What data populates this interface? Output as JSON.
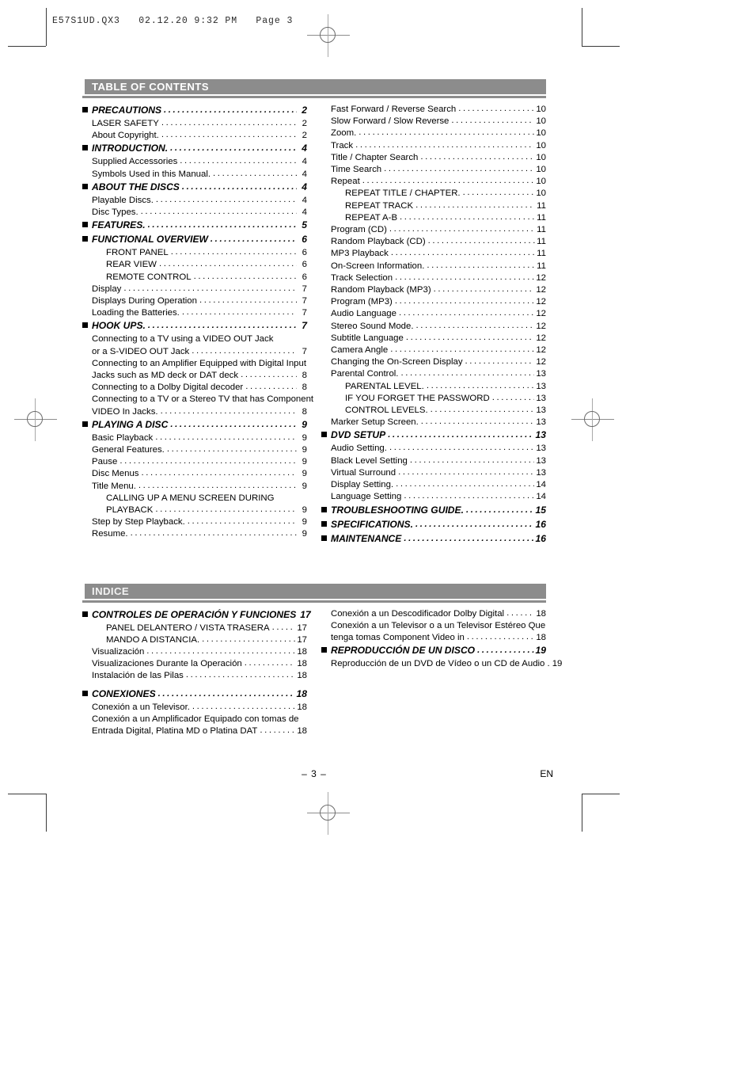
{
  "slug": "E57S1UD.QX3   02.12.20 9:32 PM   Page 3",
  "footer": {
    "page_number": "– 3 –",
    "language_code": "EN"
  },
  "colors": {
    "header_bar": "#8c8c8c",
    "header_text": "#ffffff",
    "body_text": "#000000"
  },
  "sections": [
    {
      "id": "table-of-contents",
      "title": "TABLE OF CONTENTS",
      "columns": [
        {
          "entries": [
            {
              "level": 0,
              "label": "PRECAUTIONS",
              "page": "2"
            },
            {
              "level": 1,
              "label": "LASER SAFETY",
              "page": "2"
            },
            {
              "level": 1,
              "label": "About Copyright.",
              "page": "2"
            },
            {
              "level": 0,
              "label": "INTRODUCTION.",
              "page": "4"
            },
            {
              "level": 1,
              "label": "Supplied Accessories",
              "page": "4"
            },
            {
              "level": 1,
              "label": "Symbols Used in this Manual.",
              "page": "4"
            },
            {
              "level": 0,
              "label": "ABOUT THE DISCS",
              "page": "4"
            },
            {
              "level": 1,
              "label": "Playable Discs.",
              "page": "4"
            },
            {
              "level": 1,
              "label": "Disc Types.",
              "page": "4"
            },
            {
              "level": 0,
              "label": "FEATURES.",
              "page": "5"
            },
            {
              "level": 0,
              "label": "FUNCTIONAL OVERVIEW",
              "page": "6"
            },
            {
              "level": 2,
              "label": "FRONT PANEL",
              "page": "6"
            },
            {
              "level": 2,
              "label": "REAR VIEW",
              "page": "6"
            },
            {
              "level": 2,
              "label": "REMOTE CONTROL",
              "page": "6"
            },
            {
              "level": 1,
              "label": "Display",
              "page": "7"
            },
            {
              "level": 1,
              "label": "Displays During Operation",
              "page": "7"
            },
            {
              "level": 1,
              "label": "Loading the Batteries.",
              "page": "7"
            },
            {
              "level": 0,
              "label": "HOOK UPS.",
              "page": "7"
            },
            {
              "level": 1,
              "label": "Connecting to a TV using a VIDEO OUT Jack",
              "page": "",
              "nodots": true
            },
            {
              "level": 1,
              "label": "or a S-VIDEO OUT Jack",
              "page": "7"
            },
            {
              "level": 1,
              "label": "Connecting to an Amplifier Equipped with Digital Input",
              "page": "",
              "nodots": true
            },
            {
              "level": 1,
              "label": "Jacks such as MD deck or DAT deck",
              "page": "8"
            },
            {
              "level": 1,
              "label": "Connecting to a Dolby Digital decoder",
              "page": "8"
            },
            {
              "level": 1,
              "label": "Connecting to a TV or a Stereo TV that has Component",
              "page": "",
              "nodots": true
            },
            {
              "level": 1,
              "label": "VIDEO In Jacks.",
              "page": "8"
            },
            {
              "level": 0,
              "label": "PLAYING A DISC",
              "page": "9"
            },
            {
              "level": 1,
              "label": "Basic Playback",
              "page": "9"
            },
            {
              "level": 1,
              "label": "General Features.",
              "page": "9"
            },
            {
              "level": 1,
              "label": "Pause",
              "page": "9"
            },
            {
              "level": 1,
              "label": "Disc Menus",
              "page": "9"
            },
            {
              "level": 1,
              "label": "Title Menu.",
              "page": "9"
            },
            {
              "level": 2,
              "label": "CALLING UP A MENU SCREEN DURING",
              "page": "",
              "nodots": true
            },
            {
              "level": 2,
              "label": "PLAYBACK",
              "page": "9"
            },
            {
              "level": 1,
              "label": "Step by Step Playback.",
              "page": "9"
            },
            {
              "level": 1,
              "label": "Resume.",
              "page": "9"
            }
          ]
        },
        {
          "entries": [
            {
              "level": 1,
              "label": "Fast Forward / Reverse Search",
              "page": "10"
            },
            {
              "level": 1,
              "label": "Slow Forward / Slow Reverse",
              "page": "10"
            },
            {
              "level": 1,
              "label": "Zoom.",
              "page": "10"
            },
            {
              "level": 1,
              "label": "Track",
              "page": "10"
            },
            {
              "level": 1,
              "label": "Title / Chapter Search",
              "page": "10"
            },
            {
              "level": 1,
              "label": "Time Search",
              "page": "10"
            },
            {
              "level": 1,
              "label": "Repeat",
              "page": "10"
            },
            {
              "level": 2,
              "label": "REPEAT TITLE / CHAPTER.",
              "page": "10"
            },
            {
              "level": 2,
              "label": "REPEAT TRACK",
              "page": "11"
            },
            {
              "level": 2,
              "label": "REPEAT A-B",
              "page": "11"
            },
            {
              "level": 1,
              "label": "Program (CD)",
              "page": "11"
            },
            {
              "level": 1,
              "label": "Random Playback (CD)",
              "page": "11"
            },
            {
              "level": 1,
              "label": "MP3 Playback",
              "page": "11"
            },
            {
              "level": 1,
              "label": "On-Screen Information.",
              "page": "11"
            },
            {
              "level": 1,
              "label": "Track Selection",
              "page": "12"
            },
            {
              "level": 1,
              "label": "Random Playback (MP3)",
              "page": "12"
            },
            {
              "level": 1,
              "label": "Program (MP3)",
              "page": "12"
            },
            {
              "level": 1,
              "label": "Audio Language",
              "page": "12"
            },
            {
              "level": 1,
              "label": "Stereo Sound Mode.",
              "page": "12"
            },
            {
              "level": 1,
              "label": "Subtitle Language",
              "page": "12"
            },
            {
              "level": 1,
              "label": "Camera Angle",
              "page": "12"
            },
            {
              "level": 1,
              "label": "Changing the On-Screen Display",
              "page": "12"
            },
            {
              "level": 1,
              "label": "Parental Control.",
              "page": "13"
            },
            {
              "level": 2,
              "label": "PARENTAL LEVEL.",
              "page": "13"
            },
            {
              "level": 2,
              "label": "IF YOU FORGET THE PASSWORD",
              "page": "13"
            },
            {
              "level": 2,
              "label": "CONTROL LEVELS.",
              "page": "13"
            },
            {
              "level": 1,
              "label": "Marker Setup Screen.",
              "page": "13"
            },
            {
              "level": 0,
              "label": "DVD SETUP",
              "page": "13"
            },
            {
              "level": 1,
              "label": "Audio Setting.",
              "page": "13"
            },
            {
              "level": 1,
              "label": "Black Level Setting",
              "page": "13"
            },
            {
              "level": 1,
              "label": "Virtual Surround",
              "page": "13"
            },
            {
              "level": 1,
              "label": "Display Setting.",
              "page": "14"
            },
            {
              "level": 1,
              "label": "Language Setting",
              "page": "14"
            },
            {
              "level": 0,
              "label": "TROUBLESHOOTING GUIDE.",
              "page": "15"
            },
            {
              "level": 0,
              "label": "SPECIFICATIONS.",
              "page": "16"
            },
            {
              "level": 0,
              "label": "MAINTENANCE",
              "page": "16"
            }
          ]
        }
      ]
    },
    {
      "id": "indice",
      "title": "INDICE",
      "columns": [
        {
          "entries": [
            {
              "level": 0,
              "label": "CONTROLES DE OPERACIÓN Y FUNCIONES",
              "page": "17"
            },
            {
              "level": 2,
              "label": "PANEL DELANTERO / VISTA TRASERA",
              "page": "17"
            },
            {
              "level": 2,
              "label": "MANDO A DISTANCIA.",
              "page": "17"
            },
            {
              "level": 1,
              "label": "Visualización",
              "page": "18"
            },
            {
              "level": 1,
              "label": "Visualizaciones Durante la Operación",
              "page": "18"
            },
            {
              "level": 1,
              "label": "Instalación de las Pilas",
              "page": "18"
            },
            {
              "level": 0,
              "label": "CONEXIONES",
              "page": "18",
              "spaced": true
            },
            {
              "level": 1,
              "label": "Conexión a un Televisor.",
              "page": "18"
            },
            {
              "level": 1,
              "label": "Conexión a un Amplificador Equipado con tomas de",
              "page": "",
              "nodots": true
            },
            {
              "level": 1,
              "label": "Entrada Digital, Platina MD o Platina DAT",
              "page": "18"
            }
          ]
        },
        {
          "entries": [
            {
              "level": 1,
              "label": "Conexión a un Descodificador Dolby Digital",
              "page": "18"
            },
            {
              "level": 1,
              "label": "Conexión a un Televisor o a un Televisor Estéreo Que",
              "page": "",
              "nodots": true
            },
            {
              "level": 1,
              "label": "tenga tomas Component Video in",
              "page": "18"
            },
            {
              "level": 0,
              "label": "REPRODUCCIÓN DE UN DISCO",
              "page": "19"
            },
            {
              "level": 1,
              "label": "Reproducción de un DVD de Vídeo o un CD de Audio .",
              "page": "19",
              "nodots": true,
              "inlinepage": true
            }
          ]
        }
      ]
    }
  ]
}
